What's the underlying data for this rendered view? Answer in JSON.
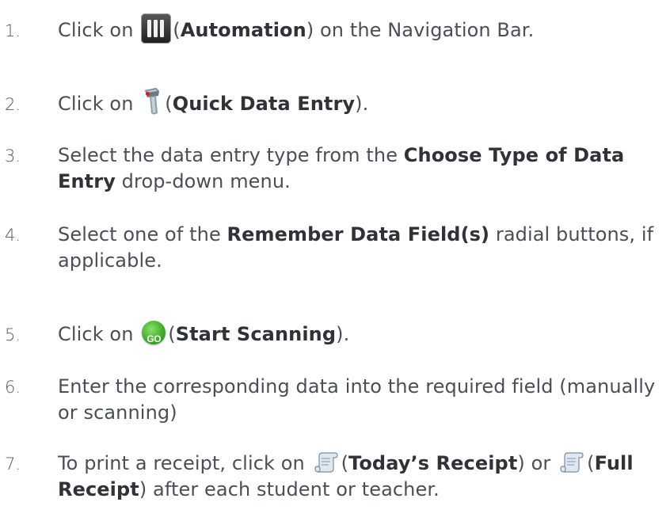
{
  "steps": [
    {
      "number": "1.",
      "parts": {
        "before": "Click on",
        "open_paren": "(",
        "bold": "Automation",
        "after": ") on the Navigation Bar."
      },
      "icon": "automation-icon"
    },
    {
      "number": "2.",
      "parts": {
        "before": "Click on",
        "open_paren": "(",
        "bold": "Quick Data Entry",
        "after": ")."
      },
      "icon": "scanner-icon"
    },
    {
      "number": "3.",
      "parts": {
        "before": "Select the data entry type from the ",
        "bold": "Choose Type of Data Entry",
        "after": " drop-down menu."
      }
    },
    {
      "number": "4.",
      "parts": {
        "before": "Select one of the ",
        "bold": "Remember Data Field(s)",
        "after": " radial buttons, if applicable."
      }
    },
    {
      "number": "5.",
      "parts": {
        "before": "Click on",
        "open_paren": "(",
        "bold": "Start Scanning",
        "after": ")."
      },
      "icon": "go-icon",
      "icon_label": "GO"
    },
    {
      "number": "6.",
      "parts": {
        "text": "Enter the corresponding data into the required field (manually or scanning)"
      }
    },
    {
      "number": "7.",
      "parts": {
        "before": "To print a receipt, click on",
        "open_paren_1": "(",
        "bold_1": "Today’s Receipt",
        "middle": ") or",
        "open_paren_2": "(",
        "bold_2": "Full Receipt",
        "after": ") after each student or teacher."
      },
      "icon": "receipt-icon"
    }
  ],
  "colors": {
    "text": "#4a4f55",
    "bold_text": "#2f3337",
    "go_green": "#3fae2a"
  }
}
